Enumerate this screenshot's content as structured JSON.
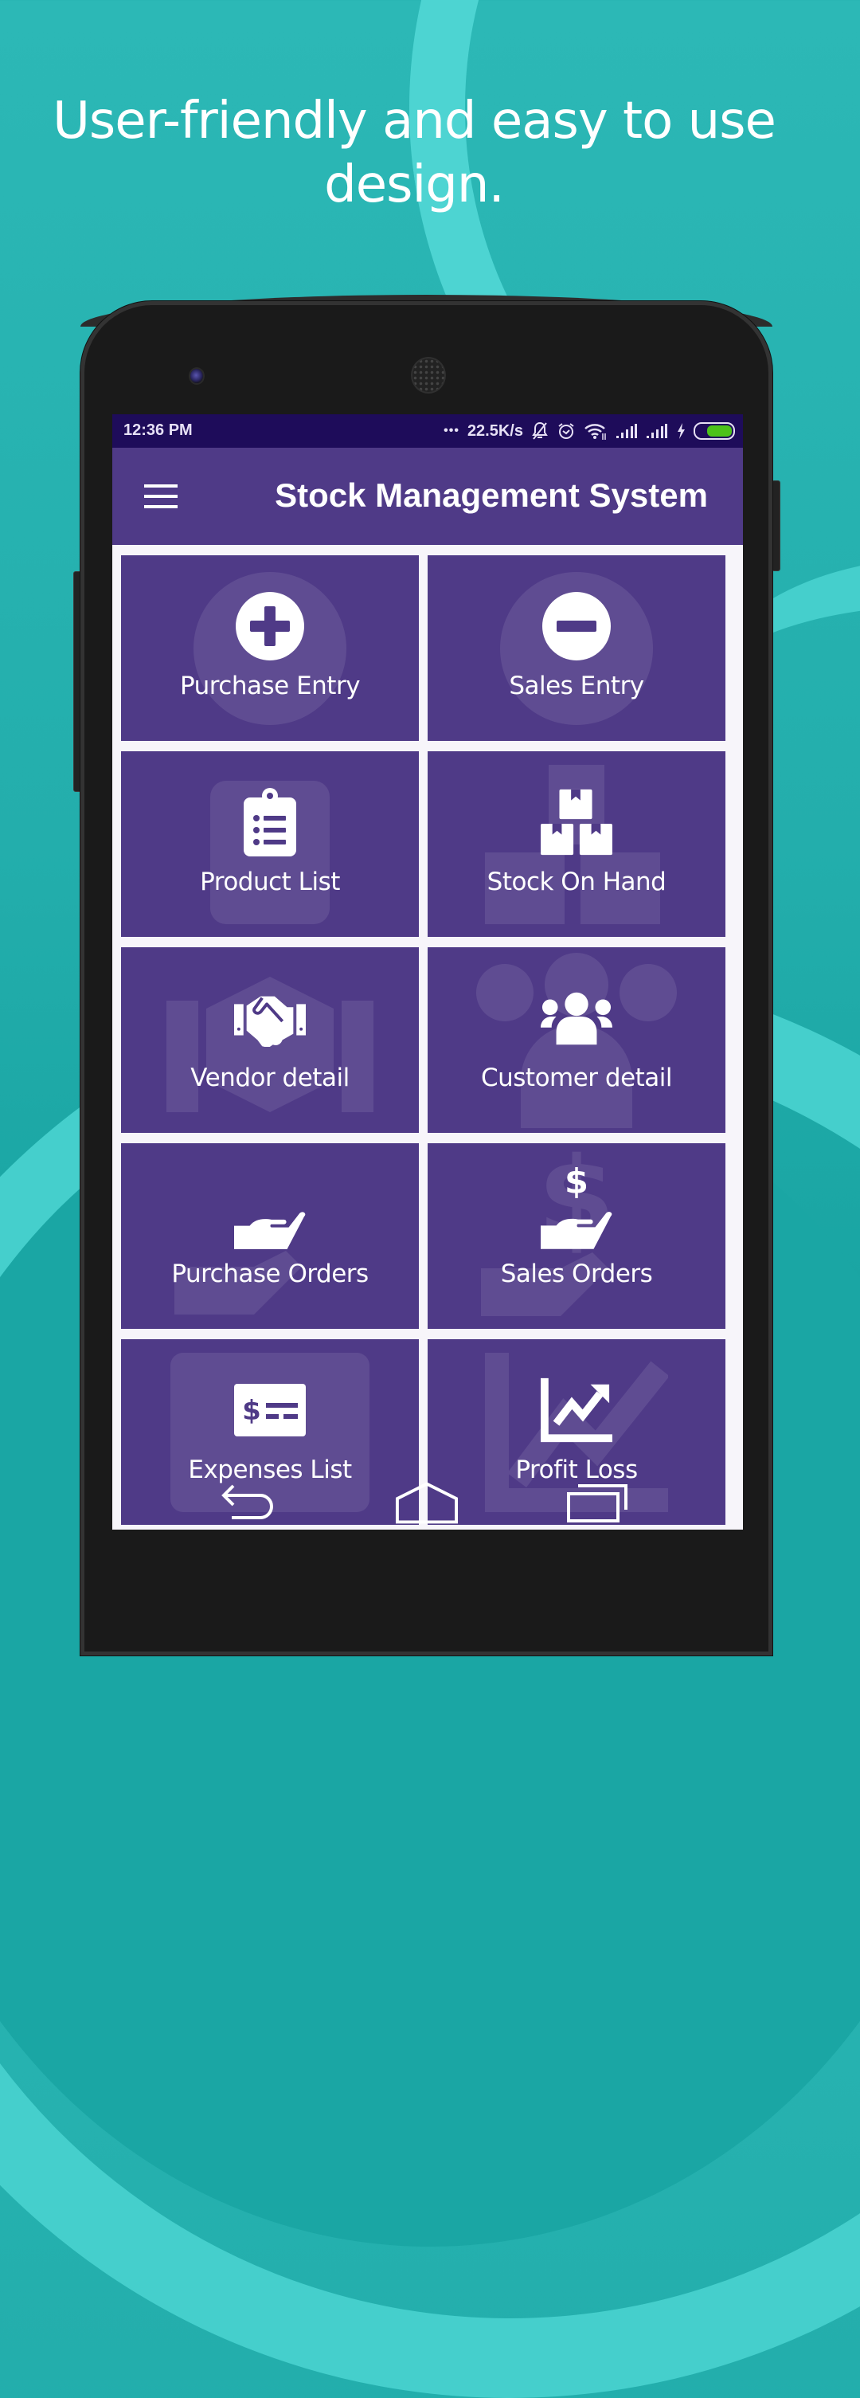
{
  "headline": {
    "line1": "User-friendly and easy to use",
    "line2": "design."
  },
  "status_bar": {
    "time": "12:36 PM",
    "more": "•••",
    "network_speed": "22.5K/s",
    "icons": [
      "bell-muted-icon",
      "alarm-icon",
      "wifi-icon",
      "signal-icon",
      "signal-icon",
      "charging-icon",
      "battery-icon"
    ],
    "battery_level_percent": 70,
    "battery_color": "#4cc21a"
  },
  "app_bar": {
    "title": "Stock Management System",
    "menu_icon": "hamburger-menu-icon"
  },
  "colors": {
    "background": "#2cb8b6",
    "accent_arc": "#4fd6d4",
    "status_bar": "#1e0c5a",
    "primary": "#4f3a87",
    "grid_background": "#f7f5fa"
  },
  "menu_tiles": [
    {
      "label": "Purchase Entry",
      "icon": "plus-circle-icon"
    },
    {
      "label": "Sales Entry",
      "icon": "minus-circle-icon"
    },
    {
      "label": "Product List",
      "icon": "clipboard-list-icon"
    },
    {
      "label": "Stock On Hand",
      "icon": "boxes-icon"
    },
    {
      "label": "Vendor detail",
      "icon": "handshake-icon"
    },
    {
      "label": "Customer detail",
      "icon": "users-icon"
    },
    {
      "label": "Purchase Orders",
      "icon": "hand-holding-icon"
    },
    {
      "label": "Sales Orders",
      "icon": "hand-holding-dollar-icon"
    },
    {
      "label": "Expenses List",
      "icon": "money-check-icon"
    },
    {
      "label": "Profit Loss",
      "icon": "chart-line-icon"
    }
  ],
  "nav_bar": {
    "back": "back-icon",
    "home": "home-icon",
    "recents": "recents-icon"
  }
}
